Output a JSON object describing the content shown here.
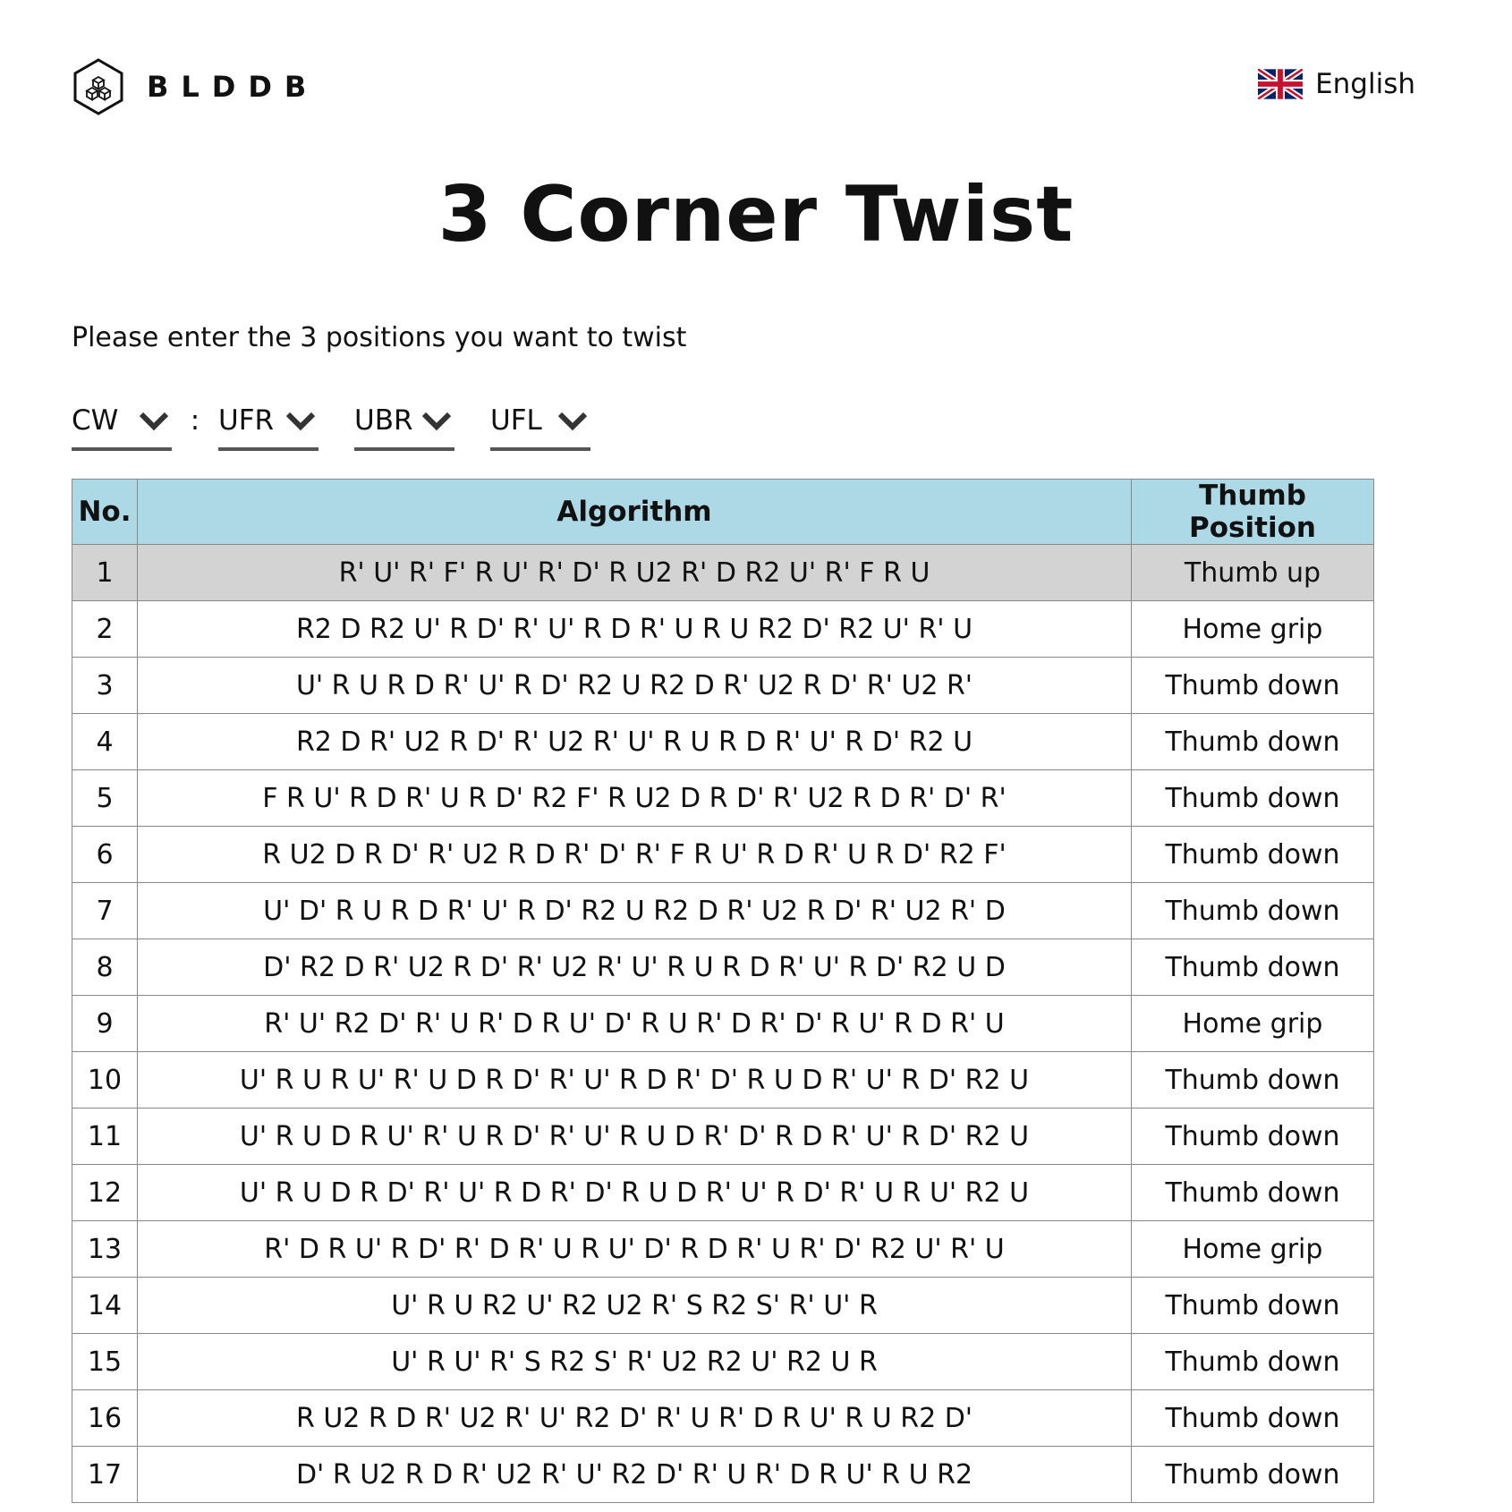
{
  "header": {
    "logo_text": "BLDDB",
    "language": "English"
  },
  "title": "3 Corner Twist",
  "prompt": "Please enter the 3 positions you want to twist",
  "selectors": {
    "direction": "CW",
    "separator": ":",
    "pos1": "UFR",
    "pos2": "UBR",
    "pos3": "UFL"
  },
  "table": {
    "headers": [
      "No.",
      "Algorithm",
      "Thumb Position"
    ],
    "rows": [
      {
        "no": "1",
        "alg": "R' U' R' F' R U' R' D' R U2 R' D R2 U' R' F R U",
        "thumb": "Thumb up"
      },
      {
        "no": "2",
        "alg": "R2 D R2 U' R D' R' U' R D R' U R U R2 D' R2 U' R' U",
        "thumb": "Home grip"
      },
      {
        "no": "3",
        "alg": "U' R U R D R' U' R D' R2 U R2 D R' U2 R D' R' U2 R'",
        "thumb": "Thumb down"
      },
      {
        "no": "4",
        "alg": "R2 D R' U2 R D' R' U2 R' U' R U R D R' U' R D' R2 U",
        "thumb": "Thumb down"
      },
      {
        "no": "5",
        "alg": "F R U' R D R' U R D' R2 F' R U2 D R D' R' U2 R D R' D' R'",
        "thumb": "Thumb down"
      },
      {
        "no": "6",
        "alg": "R U2 D R D' R' U2 R D R' D' R' F R U' R D R' U R D' R2 F'",
        "thumb": "Thumb down"
      },
      {
        "no": "7",
        "alg": "U' D' R U R D R' U' R D' R2 U R2 D R' U2 R D' R' U2 R' D",
        "thumb": "Thumb down"
      },
      {
        "no": "8",
        "alg": "D' R2 D R' U2 R D' R' U2 R' U' R U R D R' U' R D' R2 U D",
        "thumb": "Thumb down"
      },
      {
        "no": "9",
        "alg": "R' U' R2 D' R' U R' D R U' D' R U R' D R' D' R U' R D R' U",
        "thumb": "Home grip"
      },
      {
        "no": "10",
        "alg": "U' R U R U' R' U D R D' R' U' R D R' D' R U D R' U' R D' R2 U",
        "thumb": "Thumb down"
      },
      {
        "no": "11",
        "alg": "U' R U D R U' R' U R D' R' U' R U D R' D' R D R' U' R D' R2 U",
        "thumb": "Thumb down"
      },
      {
        "no": "12",
        "alg": "U' R U D R D' R' U' R D R' D' R U D R' U' R D' R' U R U' R2 U",
        "thumb": "Thumb down"
      },
      {
        "no": "13",
        "alg": "R' D R U' R D' R' D R' U R U' D' R D R' U R' D' R2 U' R' U",
        "thumb": "Home grip"
      },
      {
        "no": "14",
        "alg": "U' R U R2 U' R2 U2 R' S R2 S' R' U' R",
        "thumb": "Thumb down"
      },
      {
        "no": "15",
        "alg": "U' R U' R' S R2 S' R' U2 R2 U' R2 U R",
        "thumb": "Thumb down"
      },
      {
        "no": "16",
        "alg": "R U2 R D R' U2 R' U' R2 D' R' U R' D R U' R U R2 D'",
        "thumb": "Thumb down"
      },
      {
        "no": "17",
        "alg": "D' R U2 R D R' U2 R' U' R2 D' R' U R' D R U' R U R2",
        "thumb": "Thumb down"
      }
    ]
  }
}
